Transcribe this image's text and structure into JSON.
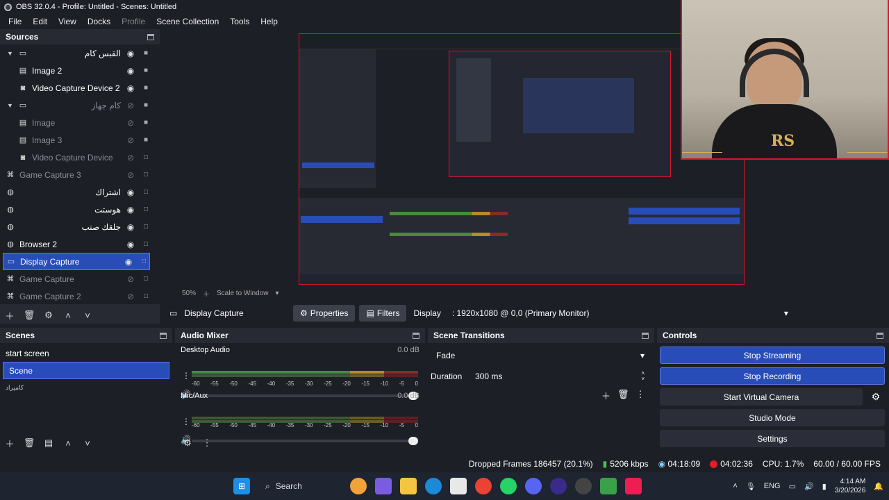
{
  "window": {
    "title": "OBS 32.0.4 - Profile: Untitled - Scenes: Untitled"
  },
  "menu": [
    "File",
    "Edit",
    "View",
    "Docks",
    "Profile",
    "Scene Collection",
    "Tools",
    "Help"
  ],
  "sources": {
    "title": "Sources",
    "items": [
      {
        "label": "القبس كام",
        "type": "folder-open",
        "rtl": true,
        "dim": false
      },
      {
        "label": "Image 2",
        "type": "image",
        "rtl": false,
        "dim": false
      },
      {
        "label": "Video Capture Device 2",
        "type": "camera",
        "rtl": false,
        "dim": false
      },
      {
        "label": "كام جهاز",
        "type": "folder-open",
        "rtl": true,
        "dim": true
      },
      {
        "label": "Image",
        "type": "image",
        "rtl": false,
        "dim": true
      },
      {
        "label": "Image 3",
        "type": "image",
        "rtl": false,
        "dim": true
      },
      {
        "label": "Video Capture Device",
        "type": "camera",
        "rtl": false,
        "dim": true
      },
      {
        "label": "Game Capture 3",
        "type": "game",
        "rtl": false,
        "dim": true
      },
      {
        "label": "اشتراك",
        "type": "globe",
        "rtl": true,
        "dim": false
      },
      {
        "label": "هوستت",
        "type": "globe",
        "rtl": true,
        "dim": false
      },
      {
        "label": "جلقك صتب",
        "type": "globe",
        "rtl": true,
        "dim": false
      },
      {
        "label": "Browser 2",
        "type": "globe",
        "rtl": false,
        "dim": false
      },
      {
        "label": "Display Capture",
        "type": "monitor",
        "rtl": false,
        "dim": false,
        "selected": true
      },
      {
        "label": "Game Capture",
        "type": "game",
        "rtl": false,
        "dim": true
      },
      {
        "label": "Game Capture 2",
        "type": "game",
        "rtl": false,
        "dim": true
      }
    ]
  },
  "preview": {
    "zoom": "50%",
    "scale_mode": "Scale to Window"
  },
  "sourcebar": {
    "source_name": "Display Capture",
    "properties": "Properties",
    "filters": "Filters",
    "display_label": "Display",
    "display_value": ": 1920x1080 @ 0,0 (Primary Monitor)"
  },
  "scenes": {
    "title": "Scenes",
    "items": [
      {
        "label": "start screen",
        "selected": false
      },
      {
        "label": "Scene",
        "selected": true
      },
      {
        "label": "كاميراد",
        "selected": false,
        "small": true
      }
    ]
  },
  "mixer": {
    "title": "Audio Mixer",
    "channels": [
      {
        "name": "Desktop Audio",
        "db": "0.0 dB"
      },
      {
        "name": "Mic/Aux",
        "db": "0.0 dB"
      }
    ],
    "ticks": [
      "-60",
      "-55",
      "-50",
      "-45",
      "-40",
      "-35",
      "-30",
      "-25",
      "-20",
      "-15",
      "-10",
      "-5",
      "0"
    ]
  },
  "transitions": {
    "title": "Scene Transitions",
    "selected": "Fade",
    "duration_label": "Duration",
    "duration_value": "300 ms"
  },
  "controls": {
    "title": "Controls",
    "stop_streaming": "Stop Streaming",
    "stop_recording": "Stop Recording",
    "start_virtual_camera": "Start Virtual Camera",
    "studio_mode": "Studio Mode",
    "settings": "Settings"
  },
  "status": {
    "dropped": "Dropped Frames 186457 (20.1%)",
    "bitrate": "5206 kbps",
    "stream_time": "04:18:09",
    "rec_time": "04:02:36",
    "cpu": "CPU: 1.7%",
    "fps": "60.00 / 60.00 FPS"
  },
  "taskbar": {
    "search": "Search",
    "lang": "ENG",
    "time": "4:14 AM",
    "date": "3/20/2026"
  },
  "colors": {
    "accent": "#284cb8",
    "preview_border": "#d3182a",
    "bg": "#1d1f26",
    "panel": "#272a33"
  }
}
